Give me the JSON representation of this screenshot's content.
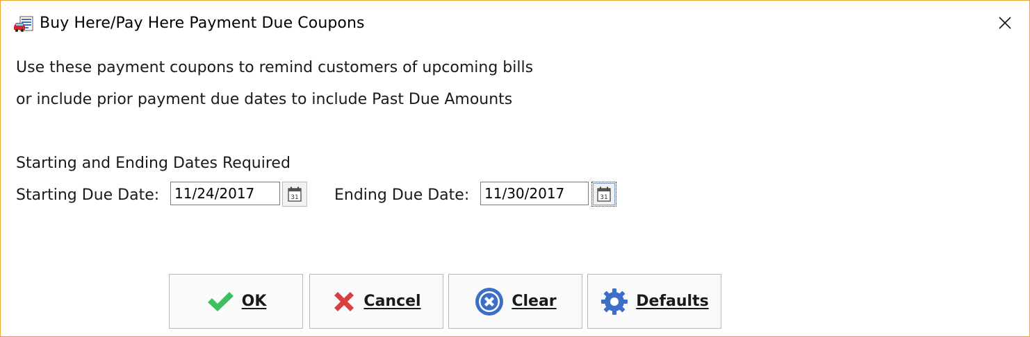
{
  "window": {
    "title": "Buy Here/Pay Here Payment Due Coupons",
    "icon": "car-coupon-icon",
    "border_color": "#f0a030"
  },
  "description": {
    "line1": "Use these payment coupons to remind customers of upcoming bills",
    "line2": "or include prior payment due dates to include Past Due Amounts"
  },
  "dates": {
    "required_label": "Starting and Ending Dates Required",
    "start_label": "Starting Due Date:",
    "start_value": "11/24/2017",
    "end_label": "Ending Due Date:",
    "end_value": "11/30/2017",
    "calendar_icon": "calendar-icon",
    "calendar_day": "31"
  },
  "buttons": {
    "ok": "OK",
    "cancel": "Cancel",
    "clear": "Clear",
    "defaults": "Defaults"
  },
  "colors": {
    "ok_check": "#3cc060",
    "cancel_x": "#d84040",
    "clear_circle": "#3e6fc8",
    "defaults_gear": "#3e6fc8"
  }
}
